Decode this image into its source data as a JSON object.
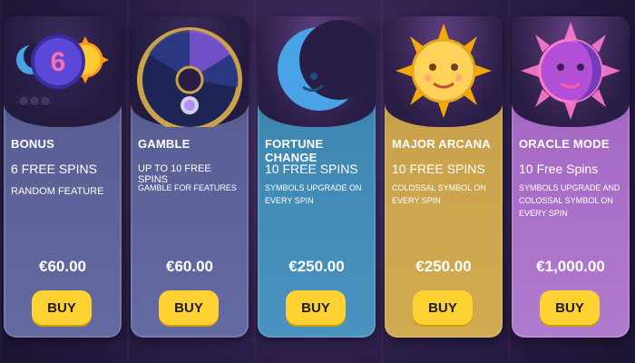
{
  "cards": [
    {
      "title": "BONUS",
      "spins": "6 FREE SPINS",
      "desc": "RANDOM FEATURE",
      "price": "€60.00",
      "buy": "BUY",
      "art": "bonus-6-coin-moon-sun-icon"
    },
    {
      "title": "GAMBLE",
      "spins": "UP TO 10 FREE SPINS",
      "desc": "GAMBLE FOR FEATURES",
      "price": "€60.00",
      "buy": "BUY",
      "art": "gamble-wheel-icon"
    },
    {
      "title": "FORTUNE CHANGE",
      "spins": "10 FREE SPINS",
      "desc": "SYMBOLS UPGRADE ON EVERY SPIN",
      "price": "€250.00",
      "buy": "BUY",
      "art": "crescent-moon-icon"
    },
    {
      "title": "MAJOR ARCANA",
      "spins": "10 FREE SPINS",
      "desc": "COLOSSAL SYMBOL ON EVERY SPIN",
      "price": "€250.00",
      "buy": "BUY",
      "art": "sun-face-icon"
    },
    {
      "title": "ORACLE MODE",
      "spins": "10 Free Spins",
      "desc": "SYMBOLS UPGRADE AND COLOSSAL SYMBOL ON EVERY SPIN",
      "price": "€1,000.00",
      "buy": "BUY",
      "art": "sun-moon-face-icon"
    }
  ],
  "colors": {
    "buy_button": "#ffd233"
  }
}
